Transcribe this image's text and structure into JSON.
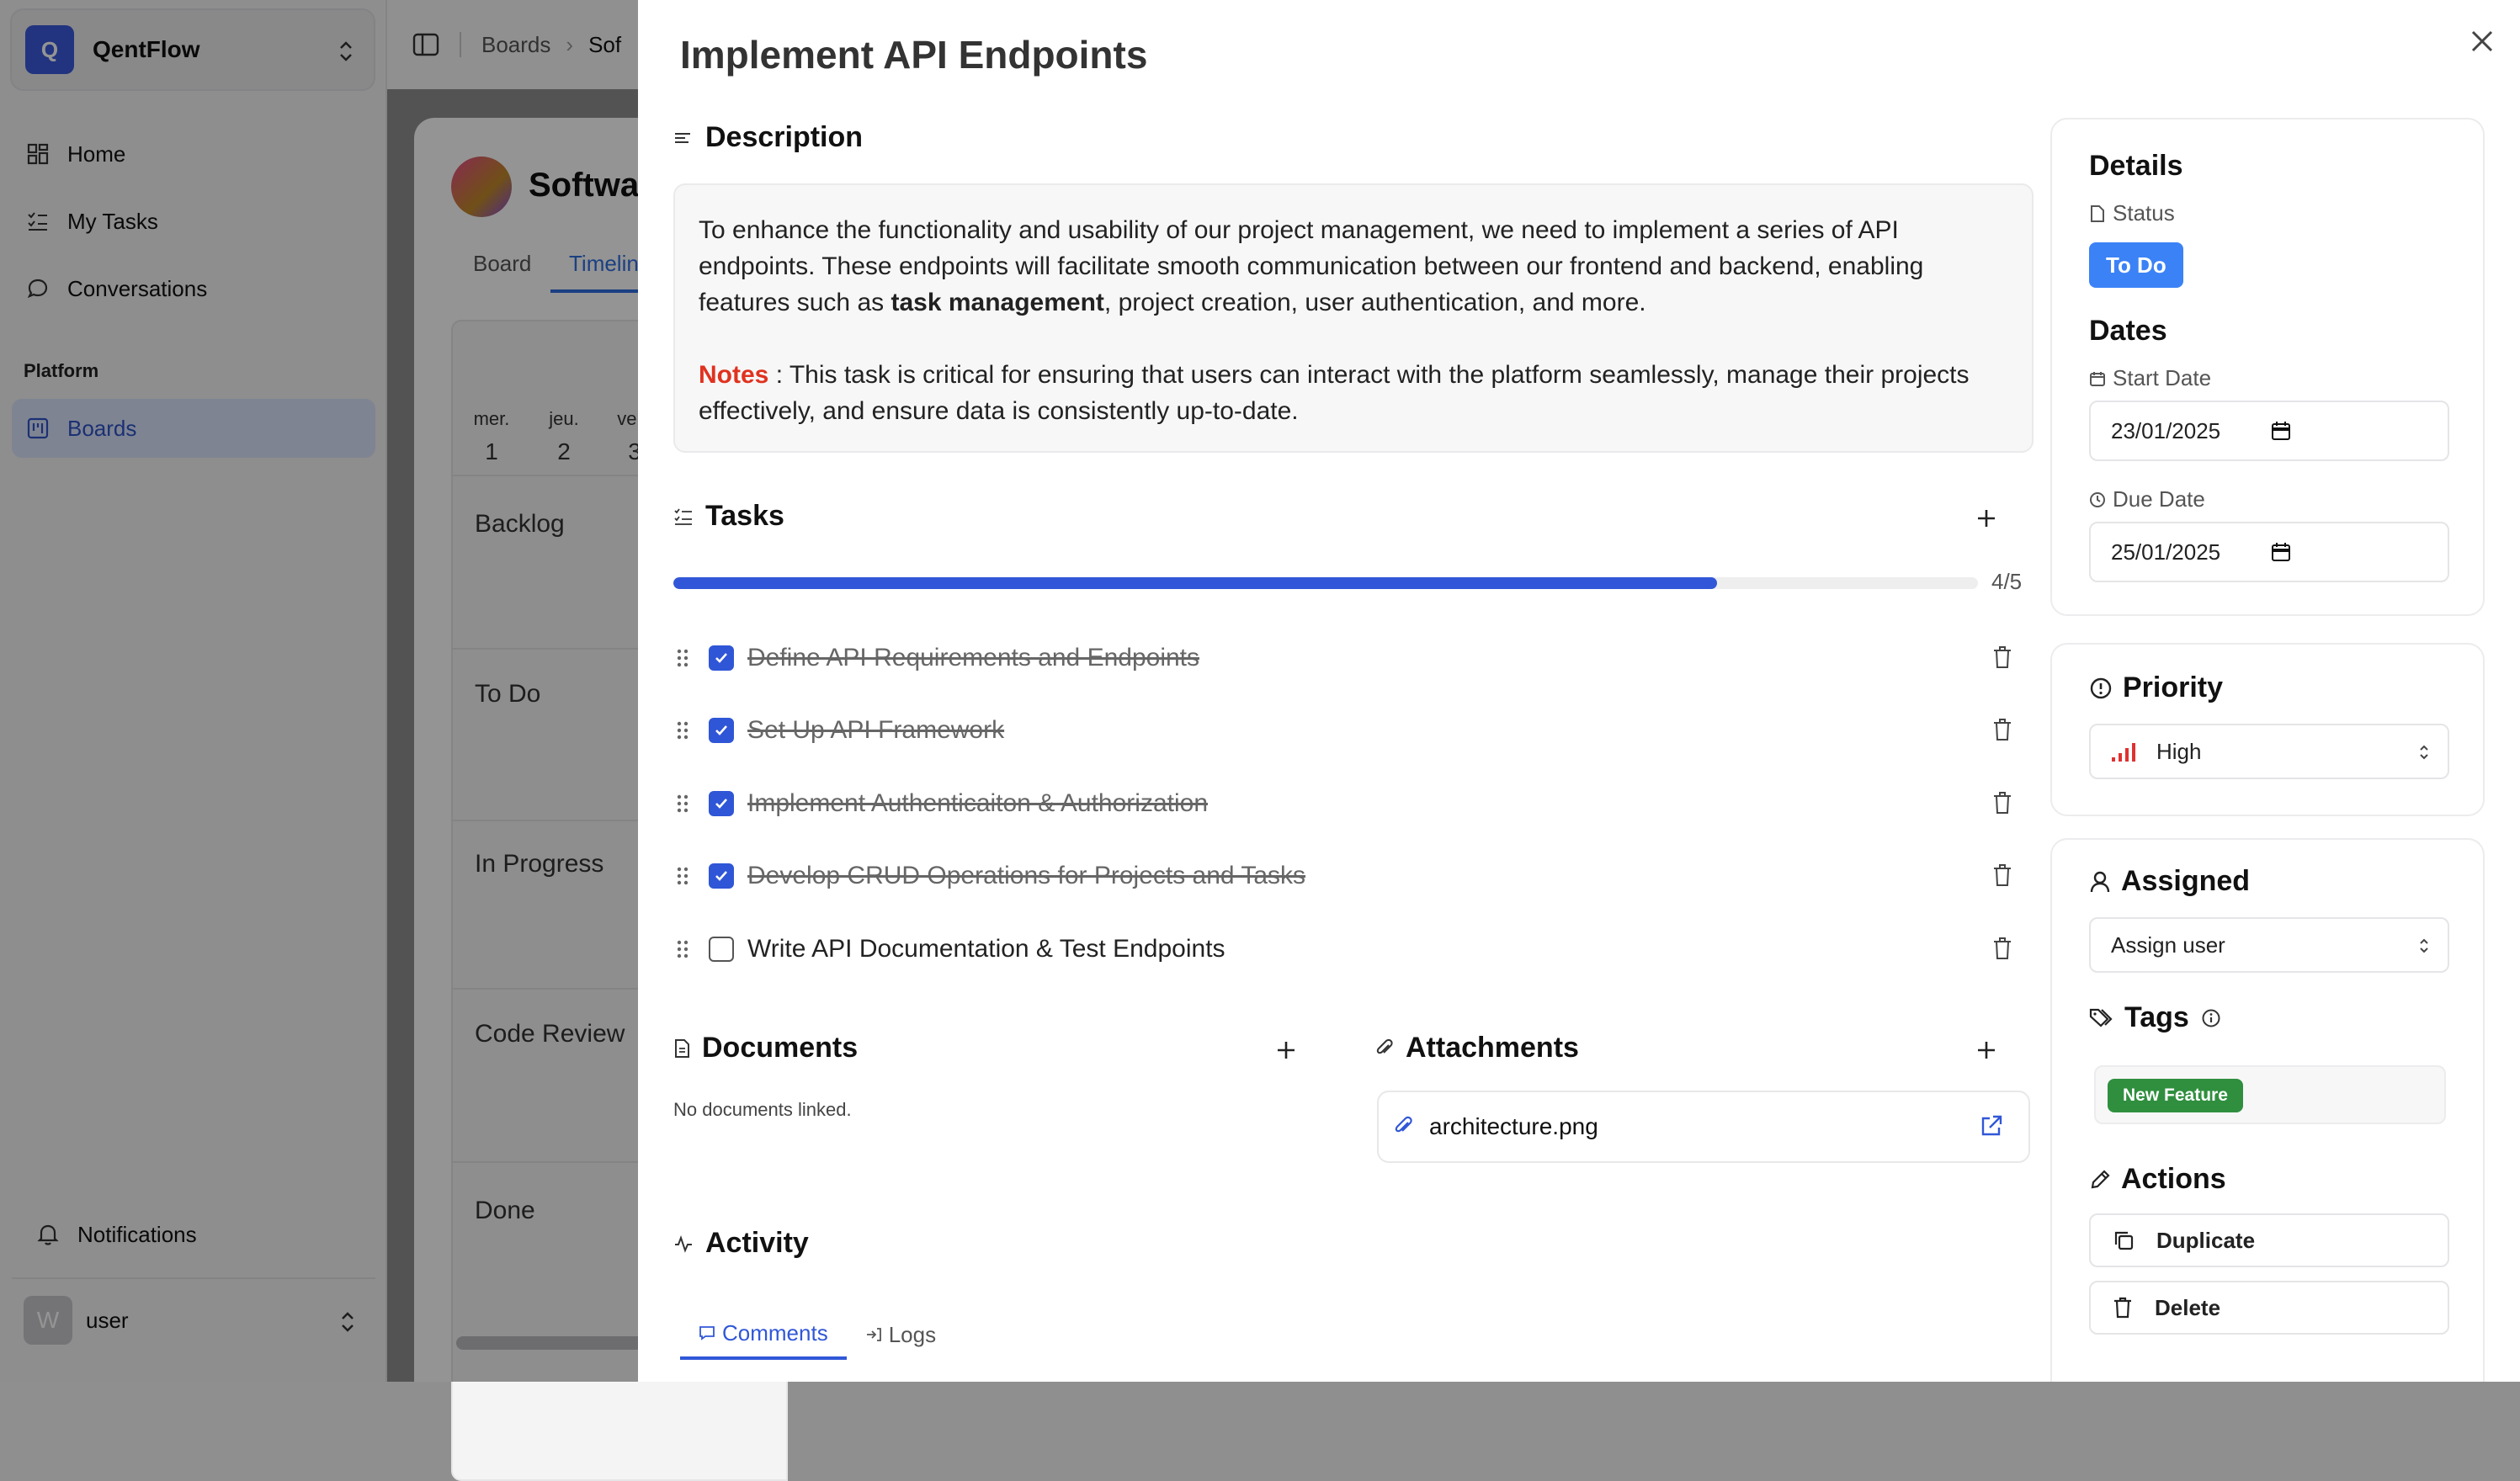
{
  "sidebar": {
    "workspace_initial": "Q",
    "workspace_name": "QentFlow",
    "nav": [
      {
        "label": "Home",
        "icon": "home-grid-icon"
      },
      {
        "label": "My Tasks",
        "icon": "list-check-icon"
      },
      {
        "label": "Conversations",
        "icon": "chat-bubble-icon"
      }
    ],
    "section": "Platform",
    "boards_label": "Boards",
    "notifications_label": "Notifications",
    "user_initial": "W",
    "user_name": "user"
  },
  "breadcrumb": {
    "root": "Boards",
    "current": "Sof"
  },
  "board": {
    "project_name": "Software",
    "tabs": [
      "Board",
      "Timeline"
    ],
    "days": [
      {
        "dow": "mer.",
        "num": "1"
      },
      {
        "dow": "jeu.",
        "num": "2"
      },
      {
        "dow": "ven.",
        "num": "3"
      }
    ],
    "lanes": [
      "Backlog",
      "To Do",
      "In Progress",
      "Code Review",
      "Done"
    ]
  },
  "panel": {
    "title": "Implement API Endpoints",
    "description": {
      "heading": "Description",
      "p1_before": "To enhance the functionality and usability of our project management, we need to implement a series of API endpoints. These endpoints will facilitate smooth communication between our frontend and backend, enabling features such as ",
      "p1_bold": "task management",
      "p1_after": ", project creation, user authentication, and more.",
      "notes_label": "Notes",
      "notes_text": " : This task is critical for ensuring that users can interact with the platform seamlessly, manage their projects effectively, and ensure data is consistently up-to-date."
    },
    "tasks": {
      "heading": "Tasks",
      "progress_text": "4/5",
      "progress_fraction": 0.8,
      "items": [
        {
          "label": "Define API Requirements and Endpoints",
          "done": true
        },
        {
          "label": "Set Up API Framework",
          "done": true
        },
        {
          "label": "Implement Authenticaiton & Authorization",
          "done": true
        },
        {
          "label": "Develop CRUD Operations for Projects and Tasks",
          "done": true
        },
        {
          "label": "Write API Documentation & Test Endpoints",
          "done": false
        }
      ]
    },
    "documents": {
      "heading": "Documents",
      "empty": "No documents linked."
    },
    "attachments": {
      "heading": "Attachments",
      "file": "architecture.png"
    },
    "activity": {
      "heading": "Activity",
      "tabs": [
        "Comments",
        "Logs"
      ]
    }
  },
  "details": {
    "heading": "Details",
    "status_label": "Status",
    "status_value": "To Do",
    "dates_heading": "Dates",
    "start_label": "Start Date",
    "start_value": "23/01/2025",
    "due_label": "Due Date",
    "due_value": "25/01/2025",
    "priority_heading": "Priority",
    "priority_value": "High",
    "assigned_heading": "Assigned",
    "assign_placeholder": "Assign user",
    "tags_heading": "Tags",
    "tags": [
      "New Feature"
    ],
    "actions_heading": "Actions",
    "actions": [
      "Duplicate",
      "Delete"
    ]
  },
  "colors": {
    "accent": "#3157d8",
    "status": "#3b82f6",
    "tag": "#2f8f3e",
    "notes": "#e0321f",
    "priority": "#e03131"
  }
}
